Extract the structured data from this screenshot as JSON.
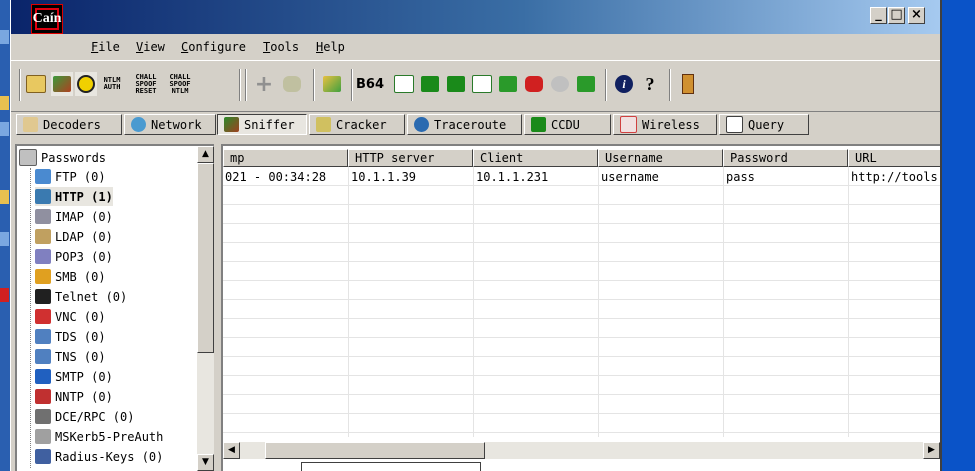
{
  "app": {
    "logo_text": "Caín"
  },
  "window_controls": {
    "minimize": "_",
    "maximize": "□",
    "close": "×"
  },
  "menu": [
    "File",
    "View",
    "Configure",
    "Tools",
    "Help"
  ],
  "toolbar": {
    "icons": [
      "open-icon",
      "sniffer-icon",
      "poison-icon",
      "ntlm-auth-icon",
      "chall-spoof-reset-icon",
      "chall-spoof-ntlm-icon",
      "add-icon",
      "delete-icon",
      "export-icon",
      "base64-icon",
      "route-icon",
      "lzh-icon",
      "vpn-icon",
      "cisco-icon",
      "hash-icon",
      "rdp-icon",
      "cert-icon",
      "key-icon",
      "info-icon",
      "help-icon",
      "cain-user-icon"
    ],
    "ntlm_auth": [
      "NTLM",
      "AUTH"
    ],
    "chall_reset": [
      "CHALL",
      "SPOOF",
      "RESET"
    ],
    "chall_ntlm": [
      "CHALL",
      "SPOOF",
      "NTLM"
    ],
    "base64": "B64"
  },
  "tabs": [
    {
      "label": "Decoders",
      "icon": "decoders-icon"
    },
    {
      "label": "Network",
      "icon": "network-icon"
    },
    {
      "label": "Sniffer",
      "icon": "sniffer-tab-icon"
    },
    {
      "label": "Cracker",
      "icon": "cracker-icon"
    },
    {
      "label": "Traceroute",
      "icon": "traceroute-icon"
    },
    {
      "label": "CCDU",
      "icon": "ccdu-icon"
    },
    {
      "label": "Wireless",
      "icon": "wireless-icon"
    },
    {
      "label": "Query",
      "icon": "query-icon"
    }
  ],
  "tree": {
    "root": "Passwords",
    "items": [
      {
        "label": "FTP  (0)",
        "icon": "ftp-icon",
        "bold": false
      },
      {
        "label": "HTTP  (1)",
        "icon": "http-icon",
        "bold": true
      },
      {
        "label": "IMAP  (0)",
        "icon": "imap-icon",
        "bold": false
      },
      {
        "label": "LDAP  (0)",
        "icon": "ldap-icon",
        "bold": false
      },
      {
        "label": "POP3  (0)",
        "icon": "pop3-icon",
        "bold": false
      },
      {
        "label": "SMB  (0)",
        "icon": "smb-icon",
        "bold": false
      },
      {
        "label": "Telnet  (0)",
        "icon": "telnet-icon",
        "bold": false
      },
      {
        "label": "VNC  (0)",
        "icon": "vnc-icon",
        "bold": false
      },
      {
        "label": "TDS  (0)",
        "icon": "tds-icon",
        "bold": false
      },
      {
        "label": "TNS  (0)",
        "icon": "tns-icon",
        "bold": false
      },
      {
        "label": "SMTP  (0)",
        "icon": "smtp-icon",
        "bold": false
      },
      {
        "label": "NNTP  (0)",
        "icon": "nntp-icon",
        "bold": false
      },
      {
        "label": "DCE/RPC  (0)",
        "icon": "dcerpc-icon",
        "bold": false
      },
      {
        "label": "MSKerb5-PreAuth",
        "icon": "mskerb5-icon",
        "bold": false
      },
      {
        "label": "Radius-Keys  (0)",
        "icon": "radius-icon",
        "bold": false
      }
    ]
  },
  "grid": {
    "columns": [
      "mp",
      "HTTP server",
      "Client",
      "Username",
      "Password",
      "URL"
    ],
    "rows": [
      [
        "021 - 00:34:28",
        "10.1.1.39",
        "10.1.1.231",
        "username",
        "pass",
        "http://tools."
      ]
    ]
  },
  "colors": {
    "titlebar": "#0a246a",
    "face": "#d4d0c8",
    "desktop": "#0a53c8",
    "logo_red": "#e00010"
  }
}
